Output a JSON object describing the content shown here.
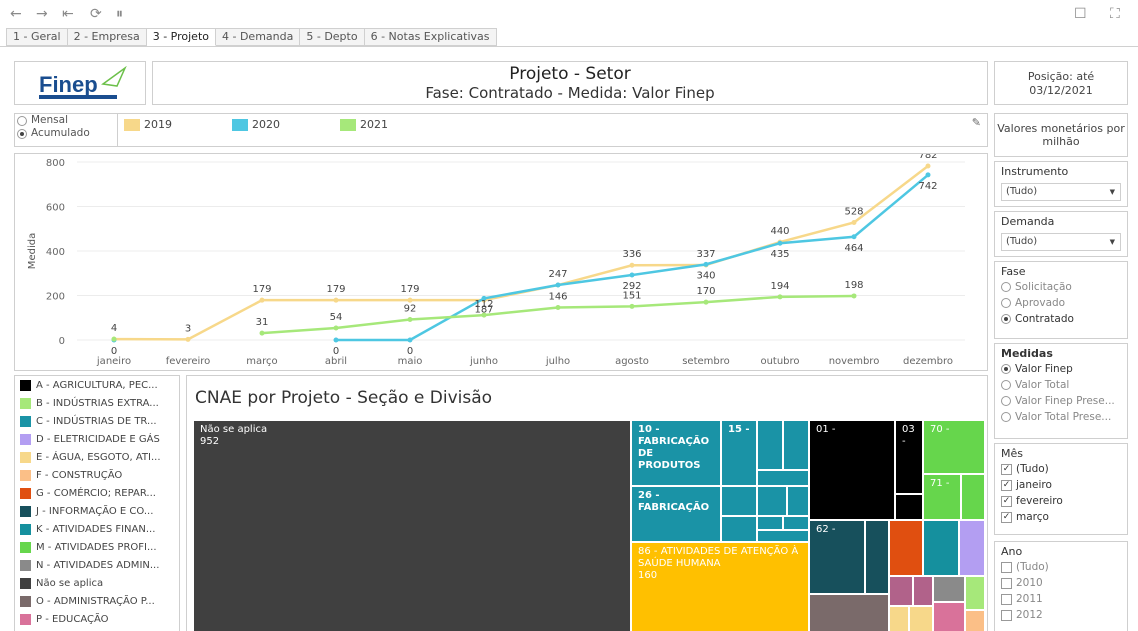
{
  "toolbar": {
    "icons": [
      "back-icon",
      "forward-icon",
      "revert-icon",
      "refresh-icon",
      "pause-icon",
      "comment-icon",
      "fullscreen-icon"
    ]
  },
  "tabs": [
    "1 - Geral",
    "2 - Empresa",
    "3 - Projeto",
    "4 - Demanda",
    "5 - Depto",
    "6 - Notas Explicativas"
  ],
  "active_tab": 2,
  "header": {
    "logo_text": "Finep",
    "title": "Projeto - Setor",
    "subtitle": "Fase:  Contratado - Medida: Valor Finep",
    "position_label": "Posição: até",
    "position_date": "03/12/2021"
  },
  "period": {
    "options": [
      "Mensal",
      "Acumulado"
    ],
    "selected": "Acumulado"
  },
  "monetary_note": "Valores monetários por milhão",
  "colors": {
    "y2019": "#f7d88a",
    "y2020": "#4ec7e2",
    "y2021": "#a6e87a"
  },
  "chart_data": {
    "type": "line",
    "ylabel": "Medida",
    "ylim": [
      0,
      800
    ],
    "yticks": [
      0,
      200,
      400,
      600,
      800
    ],
    "categories": [
      "janeiro",
      "fevereiro",
      "março",
      "abril",
      "maio",
      "junho",
      "julho",
      "agosto",
      "setembro",
      "outubro",
      "novembro",
      "dezembro"
    ],
    "series": [
      {
        "name": "2019",
        "color": "#f7d88a",
        "values": [
          4,
          3,
          179,
          179,
          179,
          179,
          247,
          336,
          337,
          440,
          528,
          782
        ]
      },
      {
        "name": "2020",
        "color": "#4ec7e2",
        "values": [
          0,
          null,
          null,
          0,
          0,
          187,
          247,
          292,
          340,
          435,
          464,
          742
        ]
      },
      {
        "name": "2021",
        "color": "#a6e87a",
        "values": [
          4,
          null,
          31,
          54,
          92,
          112,
          146,
          151,
          170,
          194,
          198,
          null
        ]
      }
    ],
    "labels": [
      {
        "i": 0,
        "v": 0,
        "t": "0",
        "series": 1
      },
      {
        "i": 0,
        "v": 4,
        "t": "4",
        "series": 0
      },
      {
        "i": 1,
        "v": 3,
        "t": "3",
        "series": 0
      },
      {
        "i": 2,
        "v": 179,
        "t": "179",
        "series": 0
      },
      {
        "i": 2,
        "v": 31,
        "t": "31",
        "series": 2
      },
      {
        "i": 3,
        "v": 179,
        "t": "179",
        "series": 0
      },
      {
        "i": 3,
        "v": 54,
        "t": "54",
        "series": 2
      },
      {
        "i": 3,
        "v": 0,
        "t": "0",
        "series": 1
      },
      {
        "i": 4,
        "v": 179,
        "t": "179",
        "series": 0
      },
      {
        "i": 4,
        "v": 92,
        "t": "92",
        "series": 2
      },
      {
        "i": 4,
        "v": 0,
        "t": "0",
        "series": 1
      },
      {
        "i": 5,
        "v": 187,
        "t": "187",
        "series": 1
      },
      {
        "i": 5,
        "v": 112,
        "t": "112",
        "series": 2
      },
      {
        "i": 6,
        "v": 247,
        "t": "247",
        "series": 0
      },
      {
        "i": 6,
        "v": 146,
        "t": "146",
        "series": 2
      },
      {
        "i": 7,
        "v": 336,
        "t": "336",
        "series": 0
      },
      {
        "i": 7,
        "v": 292,
        "t": "292",
        "series": 1
      },
      {
        "i": 7,
        "v": 151,
        "t": "151",
        "series": 2
      },
      {
        "i": 8,
        "v": 337,
        "t": "337",
        "series": 0
      },
      {
        "i": 8,
        "v": 340,
        "t": "340",
        "series": 1
      },
      {
        "i": 8,
        "v": 170,
        "t": "170",
        "series": 2
      },
      {
        "i": 9,
        "v": 440,
        "t": "440",
        "series": 0
      },
      {
        "i": 9,
        "v": 435,
        "t": "435",
        "series": 1
      },
      {
        "i": 9,
        "v": 194,
        "t": "194",
        "series": 2
      },
      {
        "i": 10,
        "v": 528,
        "t": "528",
        "series": 0
      },
      {
        "i": 10,
        "v": 464,
        "t": "464",
        "series": 1
      },
      {
        "i": 10,
        "v": 198,
        "t": "198",
        "series": 2
      },
      {
        "i": 11,
        "v": 782,
        "t": "782",
        "series": 0
      },
      {
        "i": 11,
        "v": 742,
        "t": "742",
        "series": 1
      }
    ]
  },
  "cnae_legend": [
    {
      "label": "A - AGRICULTURA, PEC...",
      "color": "#000000"
    },
    {
      "label": "B - INDÚSTRIAS EXTRA...",
      "color": "#a6e87a"
    },
    {
      "label": "C - INDÚSTRIAS DE TR...",
      "color": "#1a93a6"
    },
    {
      "label": "D - ELETRICIDADE E GÁS",
      "color": "#b39ef2"
    },
    {
      "label": "E - ÁGUA, ESGOTO, ATI...",
      "color": "#f7d88a"
    },
    {
      "label": "F - CONSTRUÇÃO",
      "color": "#fbbf87"
    },
    {
      "label": "G - COMÉRCIO; REPAR...",
      "color": "#e04f10"
    },
    {
      "label": "J - INFORMAÇÃO E CO...",
      "color": "#17505c"
    },
    {
      "label": "K - ATIVIDADES FINAN...",
      "color": "#15909e"
    },
    {
      "label": "M - ATIVIDADES PROFI...",
      "color": "#66d64c"
    },
    {
      "label": "N - ATIVIDADES ADMIN...",
      "color": "#8a8a8a"
    },
    {
      "label": "Não se aplica",
      "color": "#404040"
    },
    {
      "label": "O - ADMINISTRAÇÃO P...",
      "color": "#7a6a6a"
    },
    {
      "label": "P - EDUCAÇÃO",
      "color": "#d9729a"
    }
  ],
  "treemap": {
    "title": "CNAE por Projeto - Seção e Divisão",
    "blocks": {
      "nao_aplica": {
        "label": "Não se aplica",
        "value": "952"
      },
      "b10": {
        "label": "10 - FABRICAÇÃO DE PRODUTOS"
      },
      "b15": {
        "label": "15 -"
      },
      "b26": {
        "label": "26 - FABRICAÇÃO"
      },
      "b86": {
        "label": "86 - ATIVIDADES DE ATENÇÃO À SAÚDE HUMANA",
        "value": "160"
      },
      "b01": {
        "label": "01 -"
      },
      "b03": {
        "label": "03 -"
      },
      "b70": {
        "label": "70 -"
      },
      "b71": {
        "label": "71 -"
      },
      "b62": {
        "label": "62 -"
      }
    }
  },
  "filters": {
    "instrumento": {
      "title": "Instrumento",
      "value": "(Tudo)"
    },
    "demanda": {
      "title": "Demanda",
      "value": "(Tudo)"
    },
    "fase": {
      "title": "Fase",
      "options": [
        "Solicitação",
        "Aprovado",
        "Contratado"
      ],
      "selected": "Contratado"
    },
    "medidas": {
      "title": "Medidas",
      "options": [
        "Valor Finep",
        "Valor Total",
        "Valor Finep Prese...",
        "Valor Total Prese..."
      ],
      "selected": "Valor Finep"
    },
    "mes": {
      "title": "Mês",
      "options": [
        "(Tudo)",
        "janeiro",
        "fevereiro",
        "março"
      ]
    },
    "ano": {
      "title": "Ano",
      "options": [
        "(Tudo)",
        "2010",
        "2011",
        "2012"
      ]
    }
  }
}
